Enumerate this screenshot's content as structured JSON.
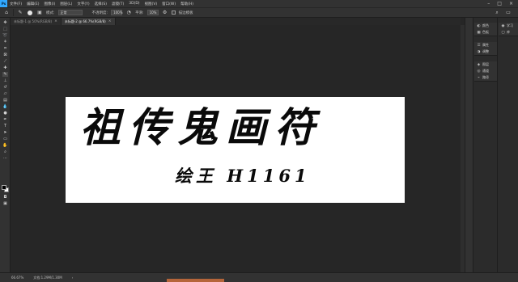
{
  "menubar": {
    "logo": "Ps",
    "items": [
      "文件(F)",
      "编辑(E)",
      "图像(I)",
      "图层(L)",
      "文字(Y)",
      "选择(S)",
      "滤镜(T)",
      "3D(D)",
      "视图(V)",
      "窗口(W)",
      "帮助(H)"
    ],
    "controls": [
      "–",
      "□",
      "×"
    ]
  },
  "options": {
    "mode_label": "模式:",
    "mode_value": "正常",
    "opacity_label": "不透明度:",
    "opacity_value": "100%",
    "flow_label": "平滑:",
    "flow_value": "10%",
    "smoothing_label": "描边模板"
  },
  "tabs": [
    {
      "label": "未标题-1 @ 50%(RGB/8)",
      "active": false
    },
    {
      "label": "未标题-2 @ 66.7%(RGB/8)",
      "active": true
    }
  ],
  "artwork": {
    "title": "祖传鬼画符",
    "signature": "绘王 H1161"
  },
  "status": {
    "zoom": "66.67%",
    "doc_info": "文档:1.29M/1.30M"
  },
  "panels": {
    "group1": [
      {
        "icon": "◐",
        "label": "颜色"
      },
      {
        "icon": "▦",
        "label": "色板"
      }
    ],
    "group2": [
      {
        "icon": "☰",
        "label": "属性"
      },
      {
        "icon": "◑",
        "label": "调整"
      }
    ],
    "group3": [
      {
        "icon": "◈",
        "label": "图层"
      },
      {
        "icon": "◎",
        "label": "通道"
      },
      {
        "icon": "⌁",
        "label": "路径"
      }
    ],
    "right1": [
      {
        "icon": "◉",
        "label": "学习"
      },
      {
        "icon": "▢",
        "label": "库"
      }
    ]
  },
  "colors": {
    "accent": "#31a8ff",
    "foreground": "#000000",
    "background": "#ffffff",
    "strip": "#b5653a"
  }
}
